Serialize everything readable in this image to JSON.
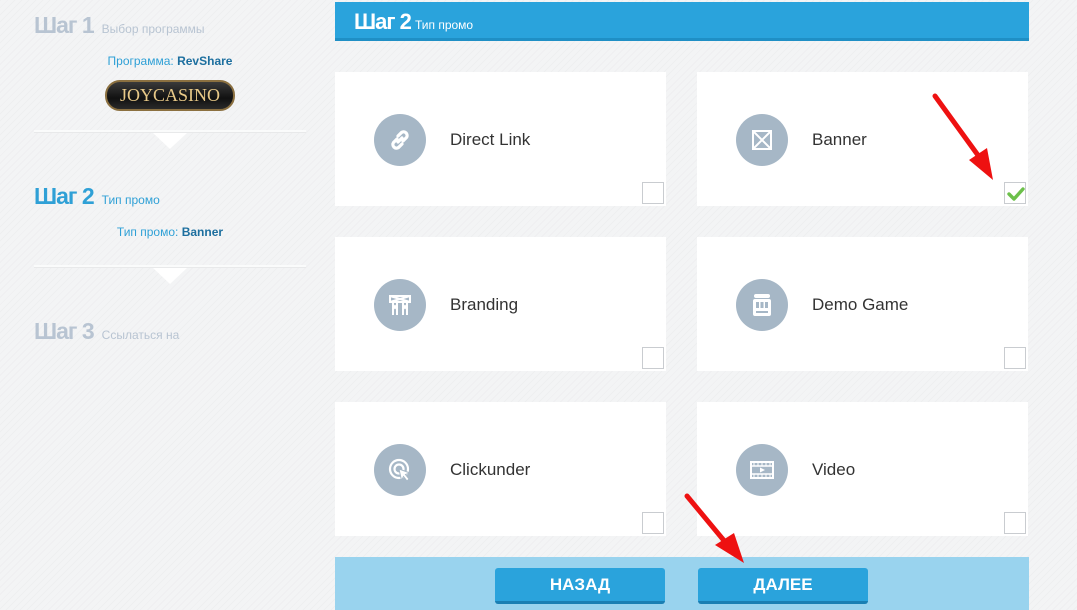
{
  "steps": [
    {
      "num": "Шаг 1",
      "label": "Выбор программы",
      "sub_key": "Программа:",
      "sub_value": "RevShare",
      "state": "inactive"
    },
    {
      "num": "Шаг 2",
      "label": "Тип промо",
      "sub_key": "Тип промо:",
      "sub_value": "Banner",
      "state": "active"
    },
    {
      "num": "Шаг 3",
      "label": "Ссылаться на",
      "state": "inactive"
    }
  ],
  "logo_text": "JOYCASINO",
  "header": {
    "num": "Шаг 2",
    "label": "Тип промо"
  },
  "promo_types": [
    {
      "label": "Direct Link",
      "icon": "link-icon",
      "checked": false
    },
    {
      "label": "Banner",
      "icon": "banner-icon",
      "checked": true
    },
    {
      "label": "Branding",
      "icon": "branding-icon",
      "checked": false
    },
    {
      "label": "Demo Game",
      "icon": "slot-machine-icon",
      "checked": false
    },
    {
      "label": "Clickunder",
      "icon": "cursor-click-icon",
      "checked": false
    },
    {
      "label": "Video",
      "icon": "video-icon",
      "checked": false
    }
  ],
  "buttons": {
    "back": "НАЗАД",
    "next": "ДАЛЕЕ"
  },
  "colors": {
    "accent": "#2aa3dc",
    "accent_light": "#99d3ee",
    "icon_bg": "#a6b7c6",
    "check": "#6cc04a",
    "annotation_arrow": "#ee1111"
  }
}
